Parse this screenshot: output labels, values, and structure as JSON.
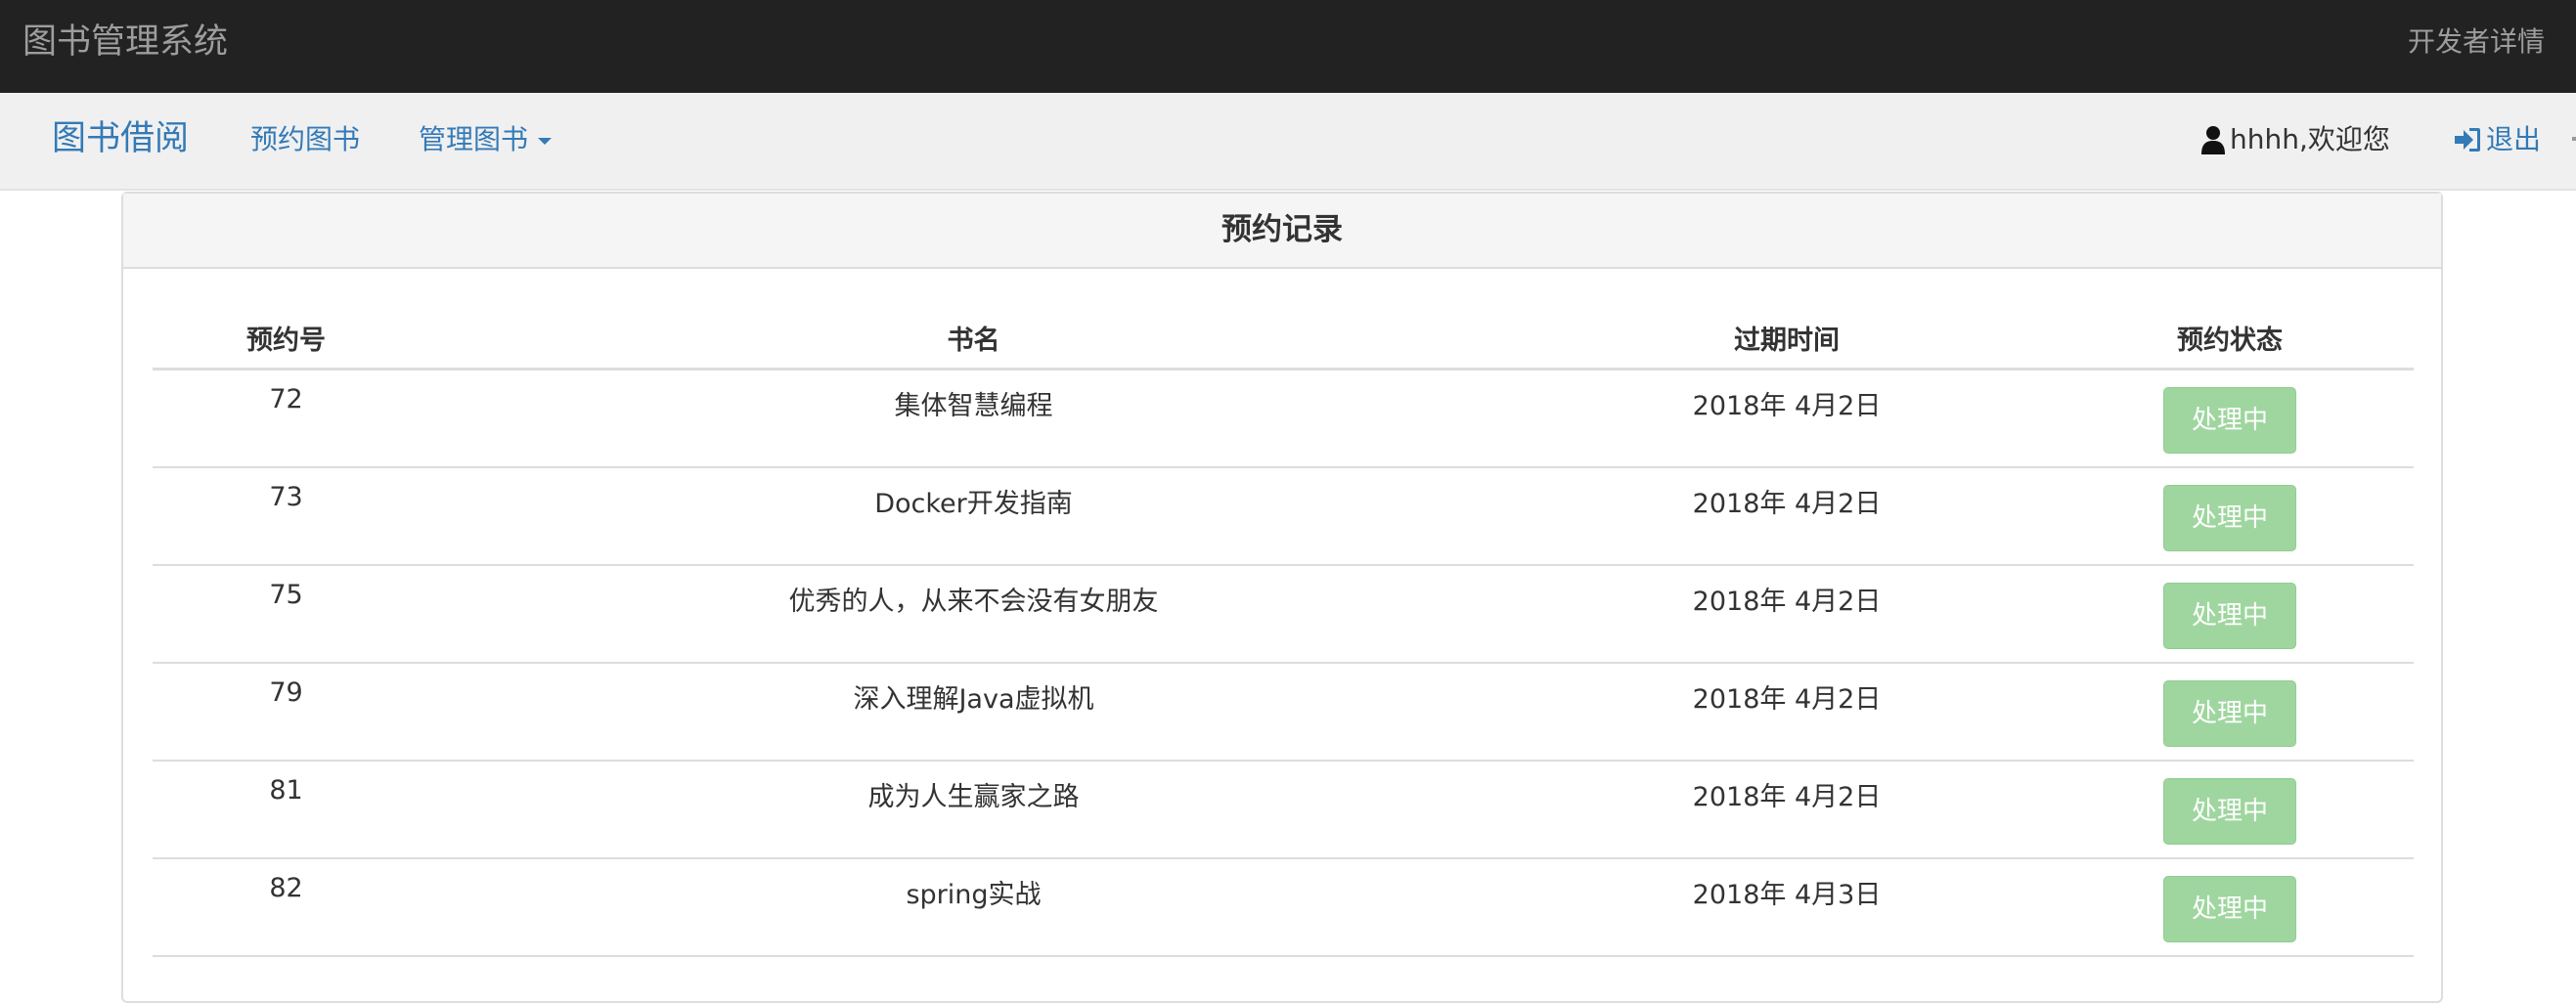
{
  "header": {
    "app_title": "图书管理系统",
    "developer_link": "开发者详情"
  },
  "nav": {
    "home": "图书借阅",
    "reserve": "预约图书",
    "manage": "管理图书",
    "user_greeting": "hhhh,欢迎您",
    "logout": "退出",
    "icons": [
      "user-icon",
      "logout-icon",
      "caret-down-icon"
    ]
  },
  "panel": {
    "title": "预约记录",
    "columns": [
      "预约号",
      "书名",
      "过期时间",
      "预约状态"
    ],
    "rows": [
      {
        "id": "72",
        "title": "集体智慧编程",
        "expire": "2018年 4月2日",
        "status": "处理中"
      },
      {
        "id": "73",
        "title": "Docker开发指南",
        "expire": "2018年 4月2日",
        "status": "处理中"
      },
      {
        "id": "75",
        "title": "优秀的人，从来不会没有女朋友",
        "expire": "2018年 4月2日",
        "status": "处理中"
      },
      {
        "id": "79",
        "title": "深入理解Java虚拟机",
        "expire": "2018年 4月2日",
        "status": "处理中"
      },
      {
        "id": "81",
        "title": "成为人生赢家之路",
        "expire": "2018年 4月2日",
        "status": "处理中"
      },
      {
        "id": "82",
        "title": "spring实战",
        "expire": "2018年 4月3日",
        "status": "处理中"
      }
    ]
  },
  "colors": {
    "topbar_bg": "#222222",
    "link": "#337ab7",
    "status_button": "#9fd69f"
  }
}
